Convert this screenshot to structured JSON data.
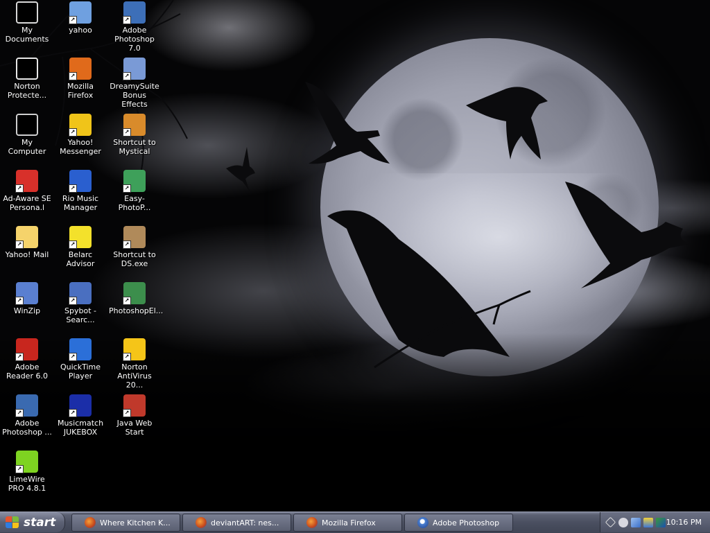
{
  "desktop": {
    "icons": [
      {
        "label": "My Documents",
        "icon": "my-documents-icon",
        "color": "#d9d9d9"
      },
      {
        "label": "yahoo",
        "icon": "yahoo-rocket-icon",
        "color": "#6fa0e0"
      },
      {
        "label": "Adobe Photoshop 7.0",
        "icon": "adobe-photoshop-icon",
        "color": "#3d6fb8"
      },
      {
        "label": "Norton Protecte...",
        "icon": "norton-protected-recycle-bin-icon",
        "color": "#e8e8e8"
      },
      {
        "label": "Mozilla Firefox",
        "icon": "firefox-icon",
        "color": "#e06a1b"
      },
      {
        "label": "DreamySuite Bonus Effects",
        "icon": "dreamysuite-icon",
        "color": "#7a9ad6"
      },
      {
        "label": "My Computer",
        "icon": "my-computer-icon",
        "color": "#cfcfcf"
      },
      {
        "label": "Yahoo! Messenger",
        "icon": "yahoo-messenger-icon",
        "color": "#f0c419"
      },
      {
        "label": "Shortcut to Mystical",
        "icon": "mystical-icon",
        "color": "#d98b2b"
      },
      {
        "label": "Ad-Aware SE Persona.l",
        "icon": "ad-aware-icon",
        "color": "#d8302a"
      },
      {
        "label": "Rio Music Manager",
        "icon": "rio-music-icon",
        "color": "#2a5fcf"
      },
      {
        "label": "Easy-PhotoP...",
        "icon": "easy-photo-icon",
        "color": "#3ea05a"
      },
      {
        "label": "Yahoo! Mail",
        "icon": "yahoo-mail-icon",
        "color": "#f5d36b"
      },
      {
        "label": "Belarc Advisor",
        "icon": "belarc-advisor-icon",
        "color": "#f3e12b"
      },
      {
        "label": "Shortcut to DS.exe",
        "icon": "ds-exe-icon",
        "color": "#b08a5a"
      },
      {
        "label": "WinZip",
        "icon": "winzip-icon",
        "color": "#5a7fd0"
      },
      {
        "label": "Spybot - Searc...",
        "icon": "spybot-icon",
        "color": "#4a6fc0"
      },
      {
        "label": "PhotoshopEl...",
        "icon": "photoshop-elements-icon",
        "color": "#3c8e4c"
      },
      {
        "label": "Adobe Reader 6.0",
        "icon": "adobe-reader-icon",
        "color": "#c8261e"
      },
      {
        "label": "QuickTime Player",
        "icon": "quicktime-icon",
        "color": "#2b6fd8"
      },
      {
        "label": "Norton AntiVirus 20...",
        "icon": "norton-antivirus-icon",
        "color": "#f5c518"
      },
      {
        "label": "Adobe Photoshop ...",
        "icon": "adobe-photoshop-shortcut-icon",
        "color": "#3a6ab0"
      },
      {
        "label": "Musicmatch JUKEBOX",
        "icon": "musicmatch-icon",
        "color": "#1b2ea8"
      },
      {
        "label": "Java Web Start",
        "icon": "java-icon",
        "color": "#c0392b"
      },
      {
        "label": "LimeWire PRO 4.8.1",
        "icon": "limewire-icon",
        "color": "#7ed321"
      }
    ]
  },
  "taskbar": {
    "start_label": "start",
    "tasks": [
      {
        "label": "Where Kitchen K...",
        "icon": "firefox-icon"
      },
      {
        "label": "deviantART: nes...",
        "icon": "firefox-icon"
      },
      {
        "label": "Mozilla Firefox",
        "icon": "firefox-icon"
      },
      {
        "label": "Adobe Photoshop",
        "icon": "adobe-photoshop-icon"
      }
    ],
    "tray_icons": [
      "show-hidden-icons-chevron",
      "messenger-tray-icon",
      "yahoo-rocket-tray-icon",
      "network-tray-icon",
      "norton-tray-icon"
    ],
    "clock": "10:16 PM"
  },
  "colors": {
    "taskbar": "#4a4f60",
    "desktop_bg": "#050506",
    "moon": "#a6a8b6"
  }
}
